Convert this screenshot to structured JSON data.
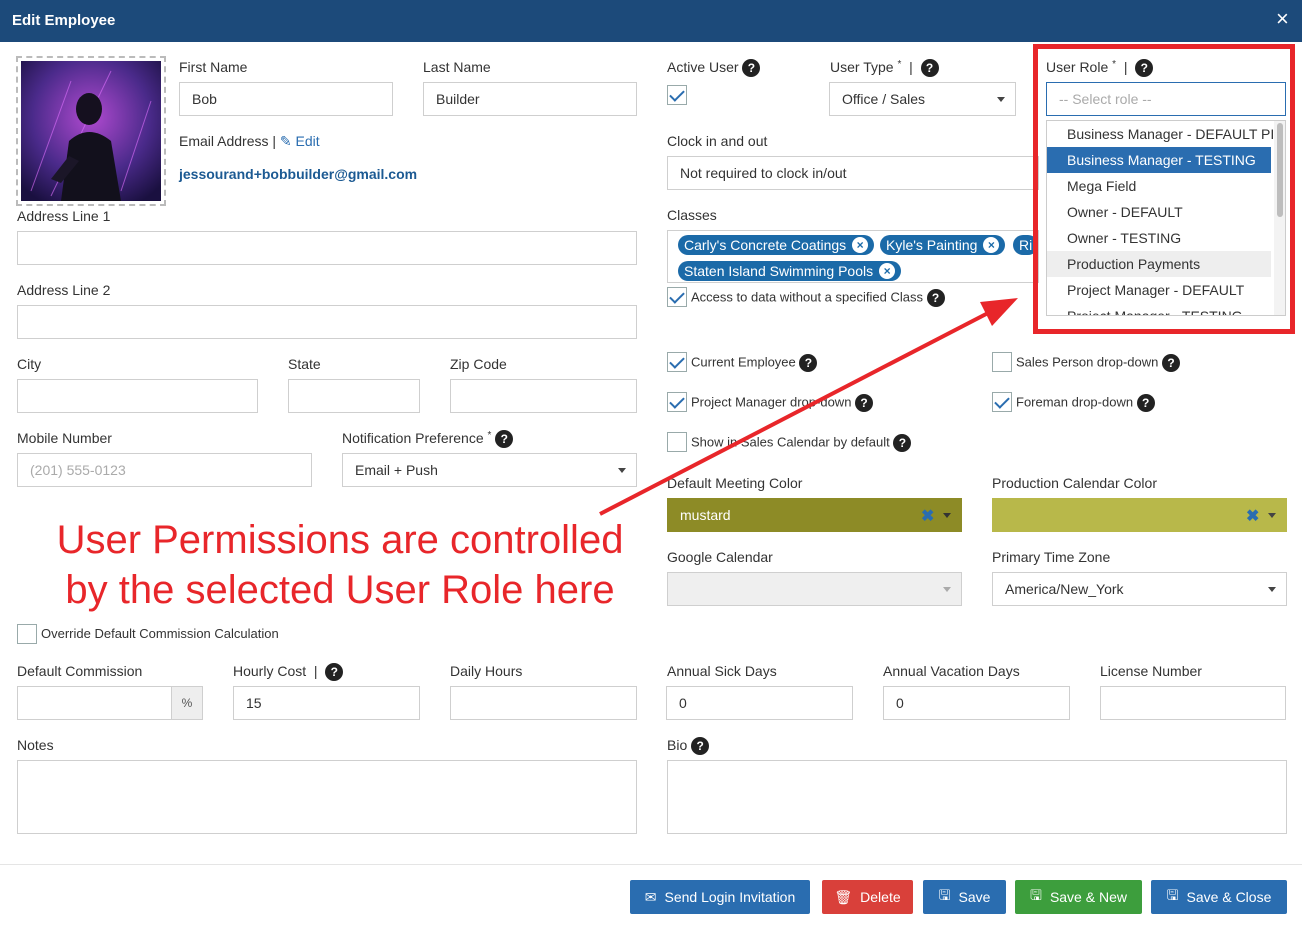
{
  "dialog": {
    "title": "Edit Employee",
    "close": "×"
  },
  "profile": {
    "first_name_label": "First Name",
    "first_name": "Bob",
    "last_name_label": "Last Name",
    "last_name": "Builder",
    "email_label": "Email Address",
    "email_edit": "Edit",
    "email": "jessourand+bobbuilder@gmail.com"
  },
  "address": {
    "line1_label": "Address Line 1",
    "line2_label": "Address Line 2",
    "city_label": "City",
    "state_label": "State",
    "zip_label": "Zip Code"
  },
  "contact": {
    "mobile_label": "Mobile Number",
    "mobile_placeholder": "(201) 555-0123",
    "notif_label": "Notification Preference",
    "notif_value": "Email + Push"
  },
  "user": {
    "active_label": "Active User",
    "type_label": "User Type",
    "type_value": "Office / Sales",
    "role_label": "User Role",
    "role_placeholder": "-- Select role --",
    "role_options": [
      "Business Manager - DEFAULT PI",
      "Business Manager - TESTING",
      "Mega Field",
      "Owner - DEFAULT",
      "Owner - TESTING",
      "Production Payments",
      "Project Manager - DEFAULT",
      "Project Manager - TESTING"
    ]
  },
  "clock": {
    "label": "Clock in and out",
    "value": "Not required to clock in/out"
  },
  "classes": {
    "label": "Classes",
    "chips": [
      "Carly's Concrete Coatings",
      "Kyle's Painting",
      "Ri",
      "Staten Island Swimming Pools"
    ],
    "access_label": "Access to data without a specified Class"
  },
  "flags": {
    "current_employee": "Current Employee",
    "sales_person": "Sales Person drop-down",
    "pm_dropdown": "Project Manager drop-down",
    "foreman": "Foreman drop-down",
    "sales_calendar": "Show in Sales Calendar by default"
  },
  "calendar": {
    "meeting_color_label": "Default Meeting Color",
    "meeting_color_value": "mustard",
    "production_color_label": "Production Calendar Color",
    "google_label": "Google Calendar",
    "timezone_label": "Primary Time Zone",
    "timezone_value": "America/New_York"
  },
  "annotation": {
    "line1": "User Permissions are controlled",
    "line2": "by the selected User Role here"
  },
  "commission": {
    "override_label": "Override Default Commission Calculation",
    "default_label": "Default Commission",
    "percent": "%",
    "hourly_label": "Hourly Cost",
    "hourly_value": "15",
    "daily_label": "Daily Hours",
    "sick_label": "Annual Sick Days",
    "sick_value": "0",
    "vacation_label": "Annual Vacation Days",
    "vacation_value": "0",
    "license_label": "License Number"
  },
  "notes": {
    "notes_label": "Notes",
    "bio_label": "Bio"
  },
  "buttons": {
    "invite": "Send Login Invitation",
    "delete": "Delete",
    "save": "Save",
    "save_new": "Save & New",
    "save_close": "Save & Close"
  },
  "colors": {
    "header": "#1c4a7a",
    "primary": "#2a6db0",
    "danger": "#d9403a",
    "success": "#3d9e3d",
    "mustard": "#8d8b26",
    "production": "#b8b84a",
    "annotation": "#e8262a"
  },
  "icons": [
    "close-icon",
    "help-icon",
    "edit-icon",
    "caret-down-icon",
    "envelope-icon",
    "trash-icon",
    "floppy-icon"
  ]
}
